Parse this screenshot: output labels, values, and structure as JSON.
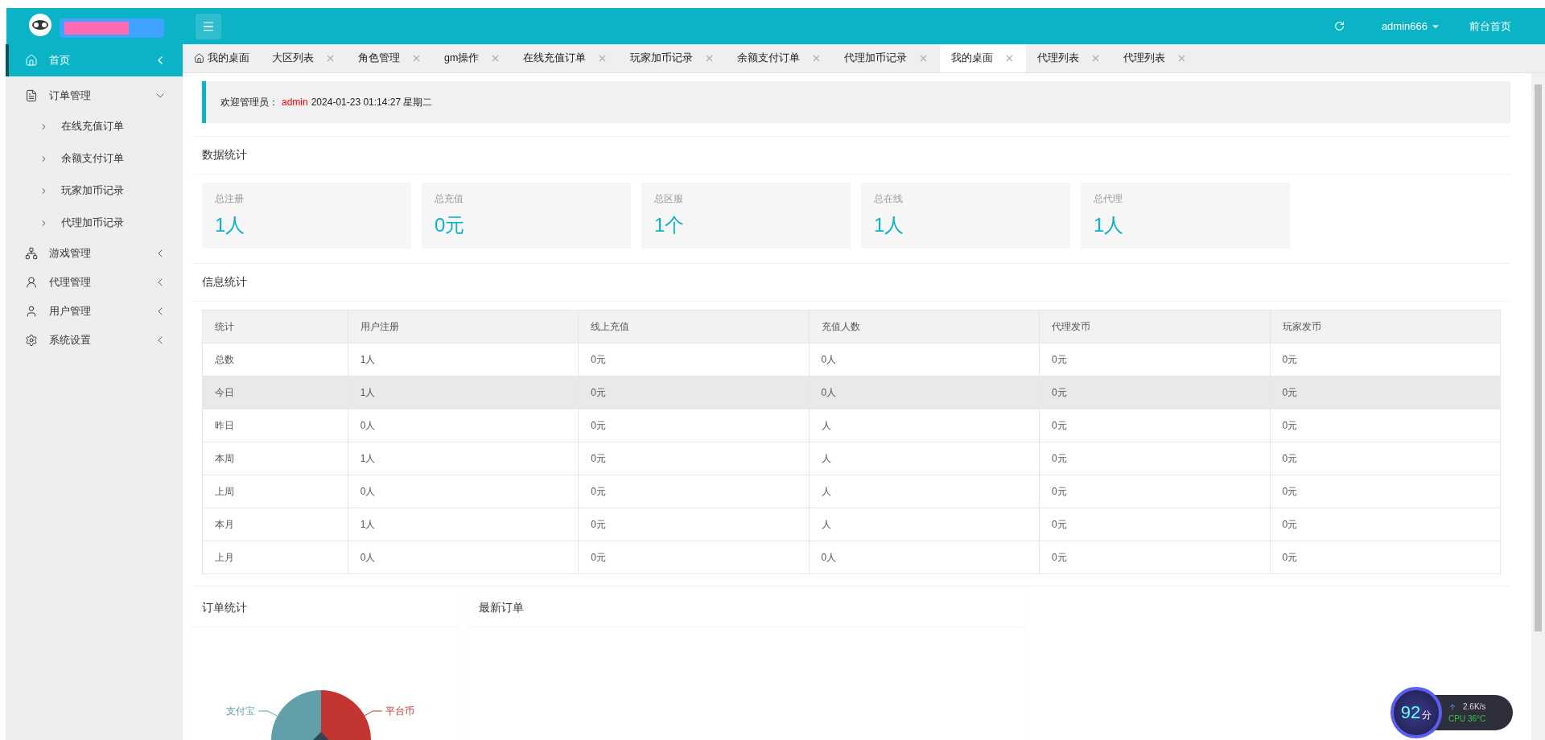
{
  "header": {
    "user": "admin666",
    "home_link": "前台首页"
  },
  "sidebar": {
    "items": [
      {
        "kind": "home",
        "label": "首页",
        "selected": true,
        "expanded": false
      },
      {
        "kind": "orders",
        "label": "订单管理",
        "selected": false,
        "expanded": true,
        "children": [
          {
            "label": "在线充值订单"
          },
          {
            "label": "余额支付订单"
          },
          {
            "label": "玩家加币记录"
          },
          {
            "label": "代理加币记录"
          }
        ]
      },
      {
        "kind": "game",
        "label": "游戏管理",
        "selected": false,
        "expanded": false
      },
      {
        "kind": "agent",
        "label": "代理管理",
        "selected": false,
        "expanded": false
      },
      {
        "kind": "user",
        "label": "用户管理",
        "selected": false,
        "expanded": false
      },
      {
        "kind": "settings",
        "label": "系统设置",
        "selected": false,
        "expanded": false
      }
    ]
  },
  "tabs": [
    {
      "label": "我的桌面",
      "home": true,
      "closable": false,
      "selected": false
    },
    {
      "label": "大区列表",
      "home": false,
      "closable": true,
      "selected": false
    },
    {
      "label": "角色管理",
      "home": false,
      "closable": true,
      "selected": false
    },
    {
      "label": "gm操作",
      "home": false,
      "closable": true,
      "selected": false
    },
    {
      "label": "在线充值订单",
      "home": false,
      "closable": true,
      "selected": false
    },
    {
      "label": "玩家加币记录",
      "home": false,
      "closable": true,
      "selected": false
    },
    {
      "label": "余额支付订单",
      "home": false,
      "closable": true,
      "selected": false
    },
    {
      "label": "代理加币记录",
      "home": false,
      "closable": true,
      "selected": false
    },
    {
      "label": "我的桌面",
      "home": false,
      "closable": true,
      "selected": true
    },
    {
      "label": "代理列表",
      "home": false,
      "closable": true,
      "selected": false
    },
    {
      "label": "代理列表",
      "home": false,
      "closable": true,
      "selected": false
    }
  ],
  "welcome": {
    "prefix": "欢迎管理员：",
    "name": "admin",
    "datetime": "2024-01-23  01:14:27  星期二"
  },
  "data_stats": {
    "title": "数据统计",
    "cards": [
      {
        "label": "总注册",
        "value": "1人"
      },
      {
        "label": "总充值",
        "value": "0元"
      },
      {
        "label": "总区服",
        "value": "1个"
      },
      {
        "label": "总在线",
        "value": "1人"
      },
      {
        "label": "总代理",
        "value": "1人"
      }
    ]
  },
  "info_stats": {
    "title": "信息统计",
    "columns": [
      "统计",
      "用户注册",
      "线上充值",
      "充值人数",
      "代理发币",
      "玩家发币"
    ],
    "rows": [
      {
        "cells": [
          "总数",
          "1人",
          "0元",
          "0人",
          "0元",
          "0元"
        ],
        "highlighted": false
      },
      {
        "cells": [
          "今日",
          "1人",
          "0元",
          "0人",
          "0元",
          "0元"
        ],
        "highlighted": true
      },
      {
        "cells": [
          "昨日",
          "0人",
          "0元",
          "人",
          "0元",
          "0元"
        ],
        "highlighted": false
      },
      {
        "cells": [
          "本周",
          "1人",
          "0元",
          "人",
          "0元",
          "0元"
        ],
        "highlighted": false
      },
      {
        "cells": [
          "上周",
          "0人",
          "0元",
          "人",
          "0元",
          "0元"
        ],
        "highlighted": false
      },
      {
        "cells": [
          "本月",
          "1人",
          "0元",
          "人",
          "0元",
          "0元"
        ],
        "highlighted": false
      },
      {
        "cells": [
          "上月",
          "0人",
          "0元",
          "0人",
          "0元",
          "0元"
        ],
        "highlighted": false
      }
    ]
  },
  "order_stats": {
    "title": "订单统计",
    "legend": [
      {
        "label": "支付宝",
        "color": "#61a0a8"
      },
      {
        "label": "平台币",
        "color": "#c23531"
      }
    ]
  },
  "latest_orders": {
    "title": "最新订单"
  },
  "monitor": {
    "score": "92",
    "unit": "分",
    "speed": "2.6K/s",
    "cpu": "CPU 36°C"
  }
}
